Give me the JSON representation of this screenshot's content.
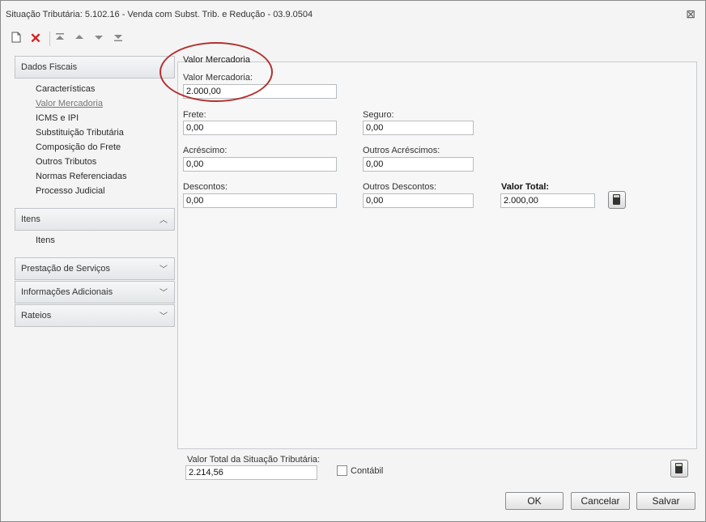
{
  "window": {
    "title": "Situação Tributária: 5.102.16 - Venda com Subst. Trib. e Redução - 03.9.0504",
    "close_glyph": "⊠"
  },
  "toolbar": {
    "icons": [
      "new-document-icon",
      "delete-icon",
      "first-record-icon",
      "previous-record-icon",
      "next-record-icon",
      "last-record-icon"
    ]
  },
  "sidebar": {
    "dados_fiscais": {
      "label": "Dados Fiscais",
      "items": [
        "Características",
        "Valor Mercadoria",
        "ICMS e IPI",
        "Substituição Tributária",
        "Composição do Frete",
        "Outros Tributos",
        "Normas Referenciadas",
        "Processo Judicial"
      ]
    },
    "itens": {
      "label": "Itens",
      "items": [
        "Itens"
      ]
    },
    "prestacao": {
      "label": "Prestação de Serviços"
    },
    "informacoes": {
      "label": "Informações Adicionais"
    },
    "rateios": {
      "label": "Rateios"
    }
  },
  "main": {
    "title": "Valor Mercadoria",
    "fields": {
      "valor_mercadoria": {
        "label": "Valor Mercadoria:",
        "value": "2.000,00"
      },
      "frete": {
        "label": "Frete:",
        "value": "0,00"
      },
      "seguro": {
        "label": "Seguro:",
        "value": "0,00"
      },
      "acrescimo": {
        "label": "Acréscimo:",
        "value": "0,00"
      },
      "outros_acrescimos": {
        "label": "Outros Acréscimos:",
        "value": "0,00"
      },
      "descontos": {
        "label": "Descontos:",
        "value": "0,00"
      },
      "outros_descontos": {
        "label": "Outros Descontos:",
        "value": "0,00"
      },
      "valor_total": {
        "label": "Valor Total:",
        "value": "2.000,00"
      }
    }
  },
  "footer": {
    "total_label": "Valor Total da Situação Tributária:",
    "total_value": "2.214,56",
    "contabil_label": "Contábil",
    "contabil_checked": false,
    "ok_label": "OK",
    "cancel_label": "Cancelar",
    "save_label": "Salvar"
  },
  "colors": {
    "highlight": "#b33030",
    "delete_icon": "#d42020"
  }
}
